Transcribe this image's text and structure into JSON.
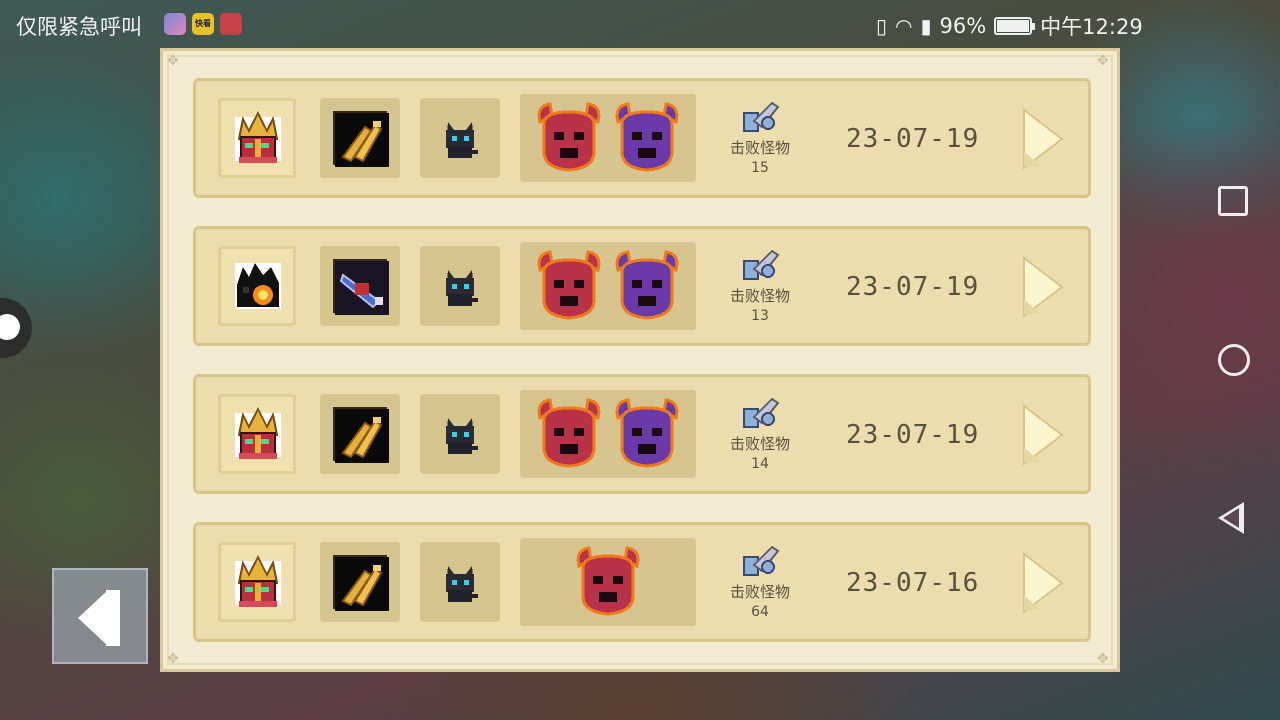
{
  "status_bar": {
    "carrier": "仅限紧急呼叫",
    "app2_label": "快看",
    "battery": "96%",
    "time": "中午12:29"
  },
  "records": [
    {
      "hero": "hero-knight-red",
      "weapon": "weapon-golden-gun",
      "pet": "pet-black-cat",
      "bosses": [
        "boss-red-devil",
        "boss-purple-devil"
      ],
      "kills_label": "击败怪物",
      "kills": "15",
      "date": "23-07-19"
    },
    {
      "hero": "hero-black-flame",
      "weapon": "weapon-blue-cannon",
      "pet": "pet-black-cat",
      "bosses": [
        "boss-red-devil",
        "boss-purple-devil"
      ],
      "kills_label": "击败怪物",
      "kills": "13",
      "date": "23-07-19"
    },
    {
      "hero": "hero-knight-red",
      "weapon": "weapon-golden-gun",
      "pet": "pet-black-cat",
      "bosses": [
        "boss-red-devil",
        "boss-purple-devil"
      ],
      "kills_label": "击败怪物",
      "kills": "14",
      "date": "23-07-19"
    },
    {
      "hero": "hero-knight-red",
      "weapon": "weapon-golden-gun",
      "pet": "pet-black-cat",
      "bosses": [
        "boss-red-devil"
      ],
      "kills_label": "击败怪物",
      "kills": "64",
      "date": "23-07-16"
    }
  ],
  "colors": {
    "panel_bg": "#f3ead2",
    "row_bg": "#ecdcae",
    "slot_bg": "#d7c58f",
    "text": "#5a5040",
    "boss_red": "#b8324a",
    "boss_purple": "#6a3aa8",
    "boss_outline": "#f07a1a"
  }
}
